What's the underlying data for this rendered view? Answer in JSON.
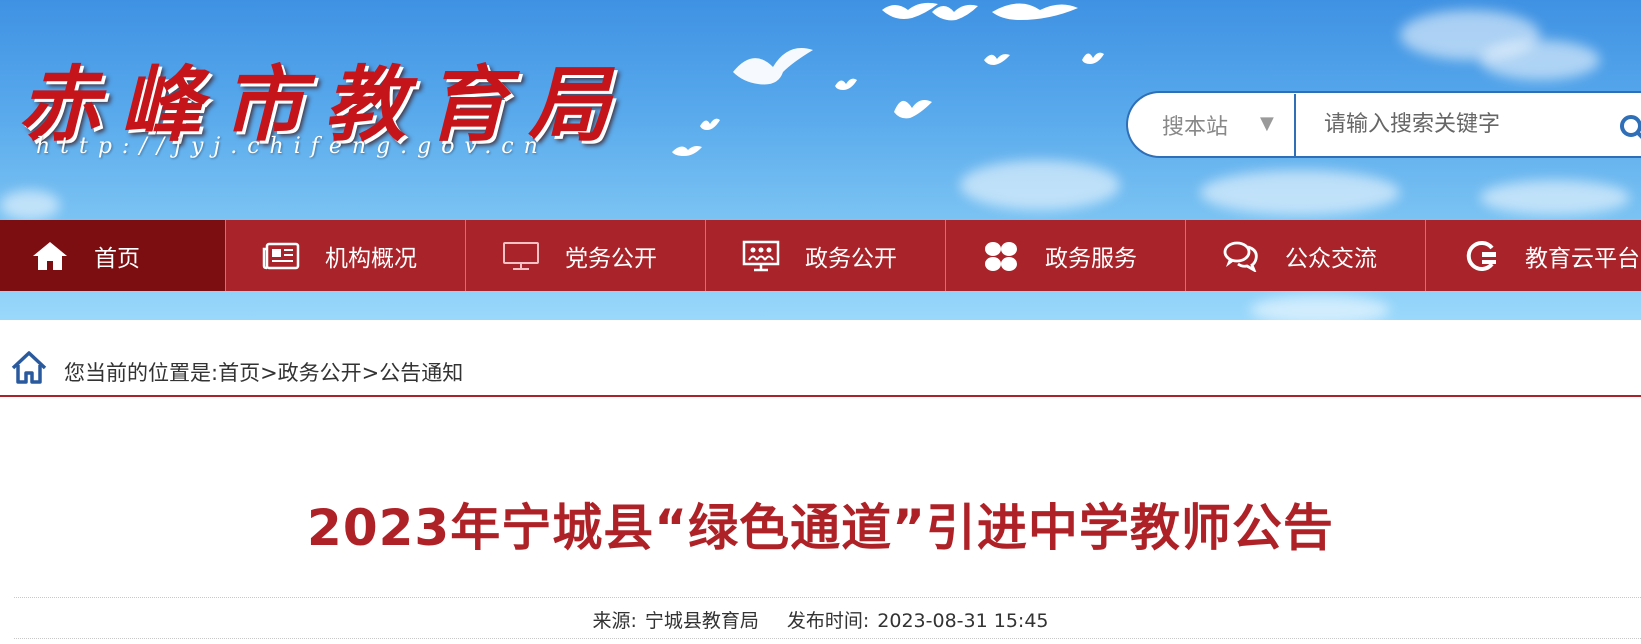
{
  "header": {
    "site_name": "赤峰市教育局",
    "site_url": "http://jyj.chifeng.gov.cn"
  },
  "search": {
    "scope_label": "搜本站",
    "placeholder": "请输入搜索关键字",
    "icons": {
      "dropdown": "triangle-down-icon",
      "submit": "magnifier-icon"
    }
  },
  "nav": {
    "items": [
      {
        "label": "首页",
        "icon": "home-icon",
        "active": true
      },
      {
        "label": "机构概况",
        "icon": "newspaper-icon"
      },
      {
        "label": "党务公开",
        "icon": "monitor-icon"
      },
      {
        "label": "政务公开",
        "icon": "presentation-icon"
      },
      {
        "label": "政务服务",
        "icon": "grid-icon"
      },
      {
        "label": "公众交流",
        "icon": "chat-icon"
      },
      {
        "label": "教育云平台",
        "icon": "cloud-icon"
      }
    ]
  },
  "breadcrumb": {
    "prefix": "您当前的位置是:",
    "path": "首页>政务公开>公告通知"
  },
  "article": {
    "title": "2023年宁城县“绿色通道”引进中学教师公告",
    "source_label": "来源:",
    "source": "宁城县教育局",
    "time_label": "发布时间:",
    "time": "2023-08-31 15:45"
  },
  "colors": {
    "nav_bg": "#a8242a",
    "nav_active": "#7c0d11",
    "title_red": "#ae2227",
    "search_border": "#2f6fb7"
  }
}
